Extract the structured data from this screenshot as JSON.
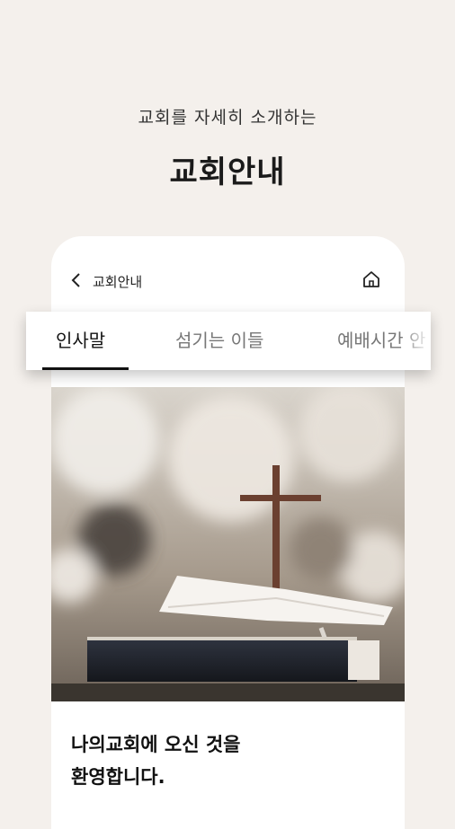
{
  "hero": {
    "subtitle": "교회를 자세히 소개하는",
    "title": "교회안내"
  },
  "app": {
    "header_title": "교회안내",
    "icons": {
      "back": "chevron-left-icon",
      "home": "home-icon"
    },
    "tabs": [
      {
        "label": "인사말",
        "active": true
      },
      {
        "label": "섬기는 이들",
        "active": false
      },
      {
        "label": "예배시간 안",
        "active": false
      }
    ],
    "welcome_line1": "나의교회에 오신 것을",
    "welcome_line2": "환영합니다."
  }
}
